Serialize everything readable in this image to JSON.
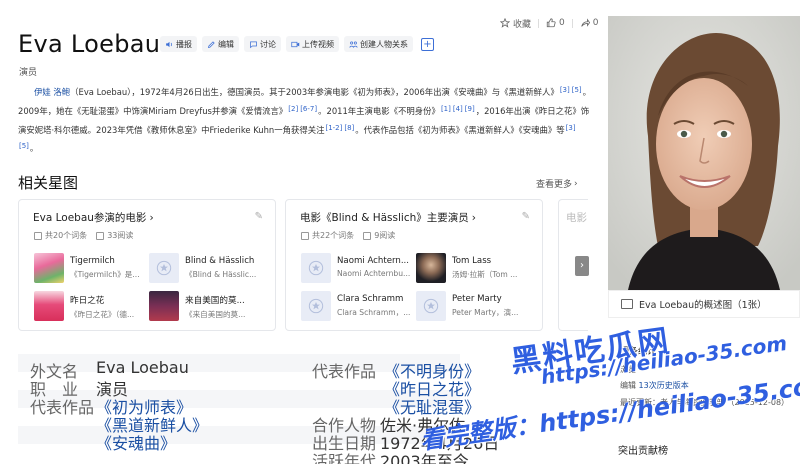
{
  "topbar": {
    "favorite": "收藏",
    "like_count": "0",
    "share_count": "0"
  },
  "title": "Eva Loebau",
  "actions": [
    {
      "label": "播报",
      "icon": "speaker-icon"
    },
    {
      "label": "编辑",
      "icon": "pencil-icon"
    },
    {
      "label": "讨论",
      "icon": "chat-icon"
    },
    {
      "label": "上传视频",
      "icon": "video-icon"
    },
    {
      "label": "创建人物关系",
      "icon": "relation-icon"
    }
  ],
  "subtitle": "演员",
  "summary": {
    "name_link": "伊娃 洛鲍",
    "p1": "（Eva Loebau），1972年4月26日出生，德国演员。其于2003年参演电影《初为师表》，2006年出演《安魂曲》与《黑道新鲜人》",
    "ref1": "[3]",
    "ref2": "[5]",
    "p2": "。2009年，她在《无耻混蛋》中饰演Miriam Dreyfus并参演《爱情流言》",
    "ref3": "[2]",
    "ref4": "[6-7]",
    "p3": "。2011年主演电影《不明身份》",
    "ref5": "[1]",
    "ref6": "[4]",
    "ref7": "[9]",
    "p4": "，2016年出演《昨日之花》饰演安妮塔·科尔德威。2023年凭借《教师休息室》中Friederike Kuhn一角获得关注",
    "ref8": "[1-2]",
    "ref9": "[8]",
    "p5": "。代表作品包括《初为师表》《黑道新鲜人》《安魂曲》等",
    "ref10": "[3]",
    "ref11": "[5]",
    "p6": "。"
  },
  "related": {
    "title": "相关星图",
    "see_more": "查看更多"
  },
  "cards": [
    {
      "title": "Eva Loebau参演的电影",
      "entries": "共20个词条",
      "reads": "33阅读",
      "items": [
        {
          "name": "Tigermilch",
          "sub": "《Tigermilch》是..."
        },
        {
          "name": "Blind & Hässlich",
          "sub": "《Blind & Hässlic..."
        },
        {
          "name": "昨日之花",
          "sub": "《昨日之花》（德..."
        },
        {
          "name": "来自美国的莫...",
          "sub": "《来自美国的莫..."
        }
      ]
    },
    {
      "title": "电影《Blind & Hässlich》主要演员",
      "entries": "共22个词条",
      "reads": "9阅读",
      "items": [
        {
          "name": "Naomi Achtern...",
          "sub": "Naomi Achternbu..."
        },
        {
          "name": "Tom Lass",
          "sub": "汤姆·拉斯（Tom ..."
        },
        {
          "name": "Clara Schramm",
          "sub": "Clara Schramm，..."
        },
        {
          "name": "Peter Marty",
          "sub": "Peter Marty，演..."
        }
      ]
    }
  ],
  "card3_partial_title": "电影",
  "infobox": {
    "rows": [
      {
        "k1": "外文名",
        "v1": "Eva Loebau",
        "k2": "代表作品",
        "v2": "《不明身份》"
      },
      {
        "k1": "职　业",
        "v1": "演员",
        "k2": "",
        "v2": "《昨日之花》"
      },
      {
        "k1": "代表作品",
        "v1": "《初为师表》",
        "k2": "",
        "v2": "《无耻混蛋》"
      },
      {
        "k1": "",
        "v1": "《黑道新鲜人》",
        "k2": "合作人物",
        "v2": "佐米·弗尔佐"
      },
      {
        "k1": "",
        "v1": "《安魂曲》",
        "k2": "出生日期",
        "v2": "1972年4月26日"
      },
      {
        "k1": "",
        "v1": "",
        "k2": "活跃年代",
        "v2": "2003年至今"
      }
    ]
  },
  "photo_caption": "Eva Loebau的概述图（1张）",
  "stats": {
    "line1": "词条统计",
    "line2": "浏览",
    "line3": "编辑",
    "history": "13次历史版本",
    "updated": "最近更新：老人与海钓俱乐部 （2025-12-08）"
  },
  "contributors": "突出贡献榜",
  "watermark": {
    "logo": "黑料吃瓜网",
    "url": "https://heiliao-35.com",
    "line2": "看完整版：https://heiliao-35.com"
  }
}
